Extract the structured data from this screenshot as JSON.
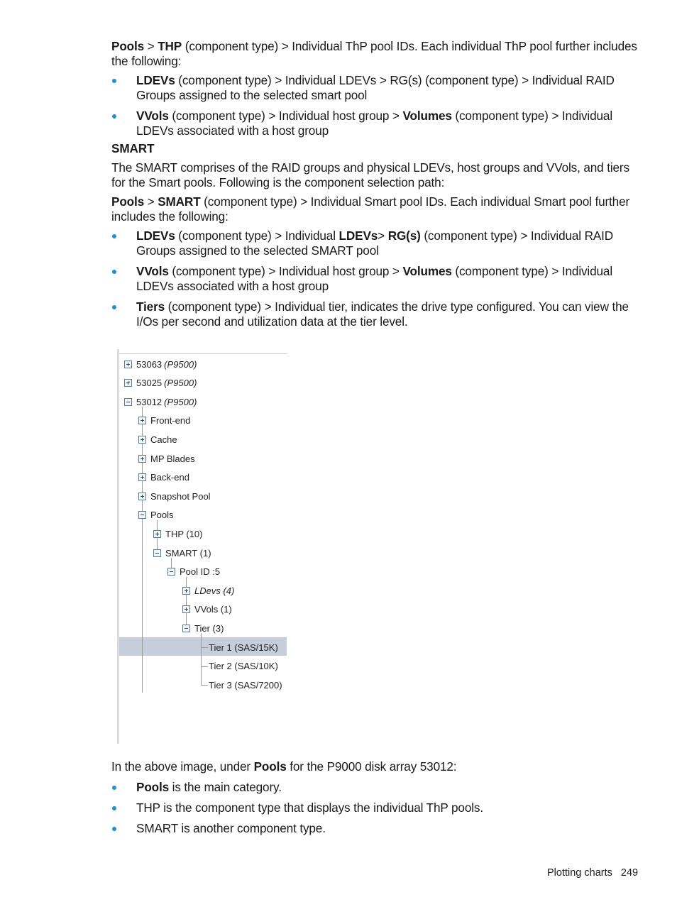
{
  "intro": {
    "path_b1": "Pools",
    "path_t1": " > ",
    "path_b2": "THP",
    "path_t2": " (component type) > Individual ThP pool IDs. Each individual ThP pool further includes the following:"
  },
  "thp_bullets": [
    {
      "b1": "LDEVs",
      "t1": " (component type) > Individual LDEVs > RG(s) (component type) > Individual RAID Groups assigned to the selected smart pool"
    },
    {
      "b1": "VVols",
      "t1": " (component type) > Individual host group > ",
      "b2": "Volumes",
      "t2": " (component type) > Individual LDEVs associated with a host group"
    }
  ],
  "smart": {
    "heading": "SMART",
    "desc": "The SMART comprises of the RAID groups and physical LDEVs, host groups and VVols, and tiers for the Smart pools. Following is the component selection path:",
    "path_b1": "Pools",
    "path_t1": " > ",
    "path_b2": "SMART",
    "path_t2": " (component type) > Individual Smart pool IDs. Each individual Smart pool further includes the following:"
  },
  "smart_bullets": [
    {
      "b1": "LDEVs",
      "t1": " (component type) > Individual ",
      "b2": "LDEVs",
      "t2": "> ",
      "b3": "RG(s)",
      "t3": " (component type) > Individual RAID Groups assigned to the selected SMART pool"
    },
    {
      "b1": "VVols",
      "t1": " (component type) > Individual host group > ",
      "b2": "Volumes",
      "t2": " (component type) > Individual LDEVs associated with a host group"
    },
    {
      "b1": "Tiers",
      "t1": " (component type) > Individual tier, indicates the drive type configured. You can view the I/Os per second and utilization data at the tier level."
    }
  ],
  "tree": {
    "nodes": [
      {
        "label": "53063",
        "model": "(P9500)",
        "state": "collapsed"
      },
      {
        "label": "53025",
        "model": "(P9500)",
        "state": "collapsed"
      },
      {
        "label": "53012",
        "model": "(P9500)",
        "state": "expanded"
      },
      {
        "label": "Front-end",
        "state": "collapsed"
      },
      {
        "label": "Cache",
        "state": "collapsed"
      },
      {
        "label": "MP Blades",
        "state": "collapsed"
      },
      {
        "label": "Back-end",
        "state": "collapsed"
      },
      {
        "label": "Snapshot Pool",
        "state": "collapsed"
      },
      {
        "label": "Pools",
        "state": "expanded"
      },
      {
        "label": "THP (10)",
        "state": "collapsed"
      },
      {
        "label": "SMART (1)",
        "state": "expanded"
      },
      {
        "label": "Pool ID :5",
        "state": "expanded"
      },
      {
        "label": "LDevs (4)",
        "state": "collapsed"
      },
      {
        "label": "VVols (1)",
        "state": "collapsed"
      },
      {
        "label": "Tier (3)",
        "state": "expanded"
      },
      {
        "label": "Tier 1 (SAS/15K)",
        "state": "leaf",
        "selected": true
      },
      {
        "label": "Tier 2 (SAS/10K)",
        "state": "leaf"
      },
      {
        "label": "Tier 3 (SAS/7200)",
        "state": "leaf"
      }
    ],
    "selection_color": "#c5ceda"
  },
  "after": {
    "t1": "In the above image, under ",
    "b1": "Pools",
    "t2": " for the P9000 disk array 53012:"
  },
  "after_bullets": [
    {
      "b1": "Pools",
      "t1": " is the main category."
    },
    {
      "t1": "THP is the component type that displays the individual ThP pools."
    },
    {
      "t1": "SMART is another component type."
    }
  ],
  "footer": {
    "section": "Plotting charts",
    "page_number": "249"
  },
  "colors": {
    "bullet": "#1d91d0",
    "text": "#1a1a1a"
  }
}
